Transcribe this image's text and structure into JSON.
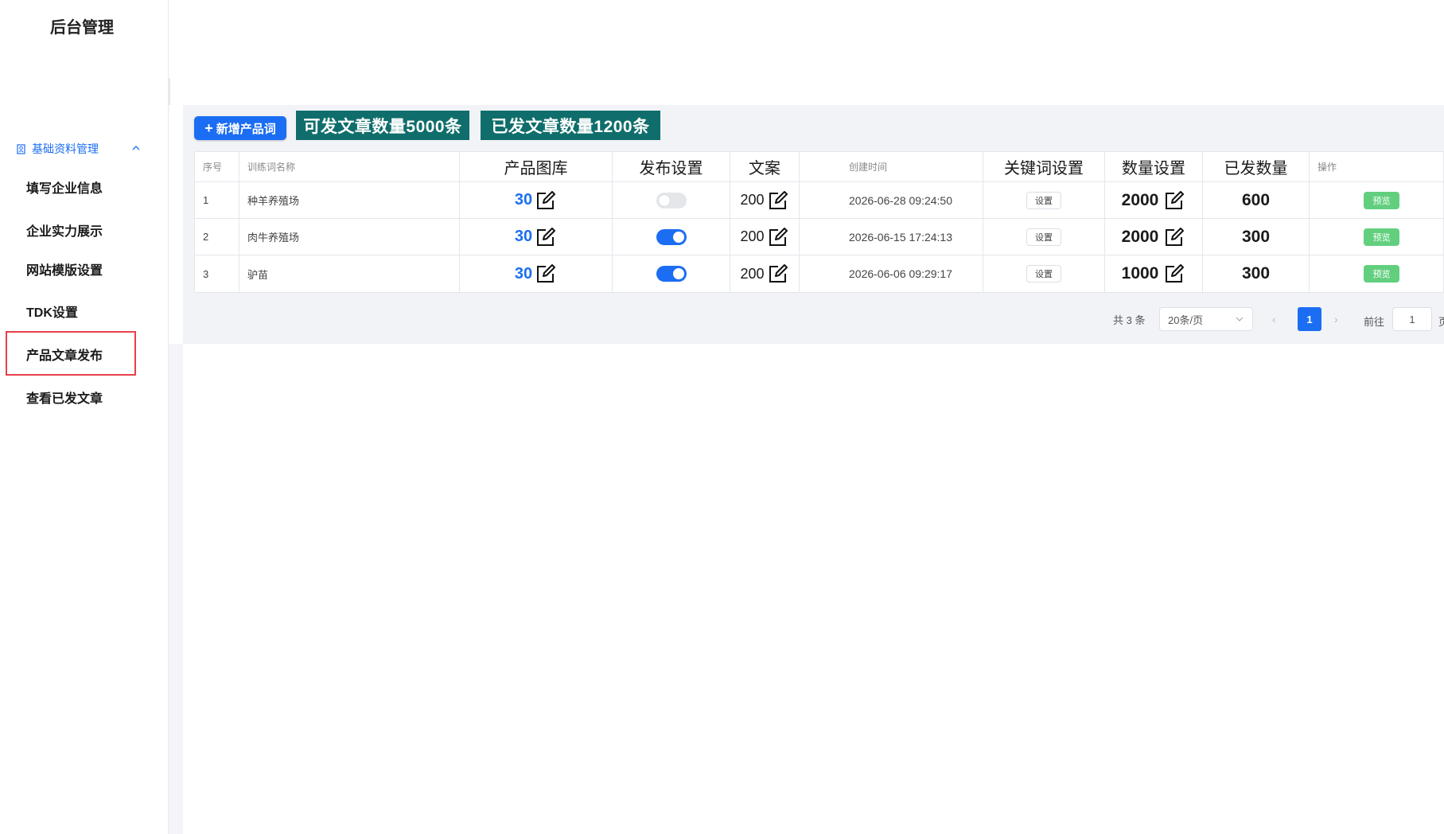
{
  "sidebar": {
    "title": "后台管理",
    "group_label": "基础资料管理",
    "items": [
      {
        "label": "填写企业信息"
      },
      {
        "label": "企业实力展示"
      },
      {
        "label": "网站模版设置"
      },
      {
        "label": "TDK设置"
      },
      {
        "label": "产品文章发布",
        "active": true
      },
      {
        "label": "查看已发文章"
      }
    ]
  },
  "toolbar": {
    "add_label": "新增产品词",
    "stat_available": "可发文章数量5000条",
    "stat_published": "已发文章数量1200条"
  },
  "table": {
    "headers": [
      "序号",
      "训练词名称",
      "产品图库",
      "发布设置",
      "文案",
      "创建时间",
      "关键词设置",
      "数量设置",
      "已发数量",
      "操作"
    ],
    "rows": [
      {
        "index": "1",
        "name": "种羊养殖场",
        "gallery": "30",
        "publish_on": false,
        "copy": "200",
        "created": "2026-06-28 09:24:50",
        "keyword_btn": "设置",
        "quantity": "2000",
        "sent": "600",
        "action": "预览"
      },
      {
        "index": "2",
        "name": "肉牛养殖场",
        "gallery": "30",
        "publish_on": true,
        "copy": "200",
        "created": "2026-06-15 17:24:13",
        "keyword_btn": "设置",
        "quantity": "2000",
        "sent": "300",
        "action": "预览"
      },
      {
        "index": "3",
        "name": "驴苗",
        "gallery": "30",
        "publish_on": true,
        "copy": "200",
        "created": "2026-06-06 09:29:17",
        "keyword_btn": "设置",
        "quantity": "1000",
        "sent": "300",
        "action": "预览"
      }
    ]
  },
  "pagination": {
    "total": "共 3 条",
    "page_size": "20条/页",
    "current_page": "1",
    "goto_label": "前往",
    "goto_value": "1",
    "unit": "页"
  },
  "colors": {
    "primary": "#1b6ef3",
    "stat_badge": "#0f6e6b",
    "preview": "#62cf7e",
    "active_border": "#e8414b"
  }
}
